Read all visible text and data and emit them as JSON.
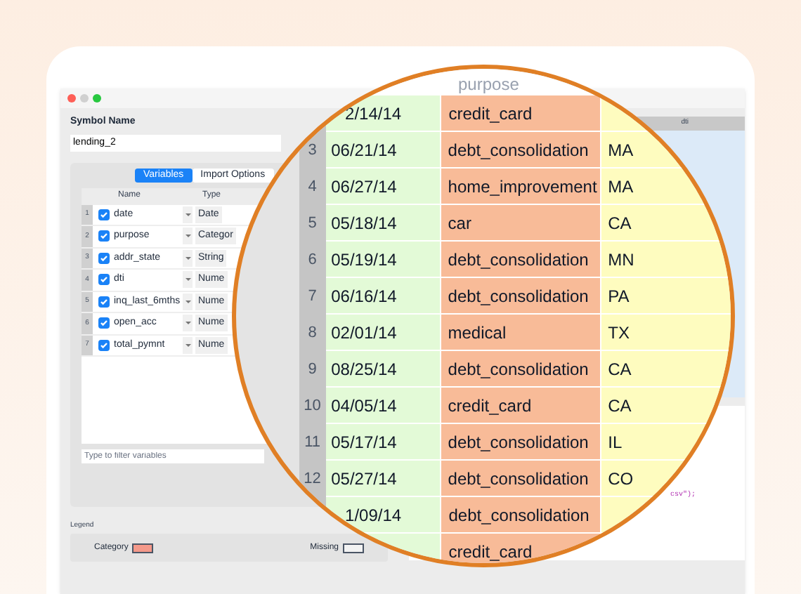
{
  "symbol_name": {
    "label": "Symbol Name",
    "value": "lending_2"
  },
  "tabs": [
    {
      "label": "Variables",
      "selected": true
    },
    {
      "label": "Import Options",
      "selected": false
    }
  ],
  "variables": {
    "columns": [
      "Name",
      "Type"
    ],
    "rows": [
      {
        "index": "1",
        "checked": true,
        "name": "date",
        "type": "Date"
      },
      {
        "index": "2",
        "checked": true,
        "name": "purpose",
        "type": "Categor"
      },
      {
        "index": "3",
        "checked": true,
        "name": "addr_state",
        "type": "String"
      },
      {
        "index": "4",
        "checked": true,
        "name": "dti",
        "type": "Nume"
      },
      {
        "index": "5",
        "checked": true,
        "name": "inq_last_6mths",
        "type": "Nume"
      },
      {
        "index": "6",
        "checked": true,
        "name": "open_acc",
        "type": "Nume"
      },
      {
        "index": "7",
        "checked": true,
        "name": "total_pymnt",
        "type": "Nume"
      }
    ]
  },
  "filter": {
    "placeholder": "Type to filter variables"
  },
  "legend": {
    "title": "Legend",
    "items": [
      {
        "label": "Category",
        "color": "#f4998a"
      },
      {
        "label": "Missing",
        "color": "#f2f2f2"
      }
    ]
  },
  "preview": {
    "column_header": "dti",
    "code": "csv\");"
  },
  "magnifier": {
    "header": "purpose",
    "rows": [
      {
        "date": "2/14/14",
        "purpose": "credit_card"
      },
      {
        "index": "3",
        "date": "06/21/14",
        "purpose": "debt_consolidation",
        "state": "MA"
      },
      {
        "index": "4",
        "date": "06/27/14",
        "purpose": "home_improvement",
        "state": "MA"
      },
      {
        "index": "5",
        "date": "05/18/14",
        "purpose": "car",
        "state": "CA"
      },
      {
        "index": "6",
        "date": "05/19/14",
        "purpose": "debt_consolidation",
        "state": "MN"
      },
      {
        "index": "7",
        "date": "06/16/14",
        "purpose": "debt_consolidation",
        "state": "PA"
      },
      {
        "index": "8",
        "date": "02/01/14",
        "purpose": "medical",
        "state": "TX"
      },
      {
        "index": "9",
        "date": "08/25/14",
        "purpose": "debt_consolidation",
        "state": "CA"
      },
      {
        "index": "10",
        "date": "04/05/14",
        "purpose": "credit_card",
        "state": "CA"
      },
      {
        "index": "11",
        "date": "05/17/14",
        "purpose": "debt_consolidation",
        "state": "IL"
      },
      {
        "index": "12",
        "date": "05/27/14",
        "purpose": "debt_consolidation",
        "state": "CO"
      },
      {
        "date": "1/09/14",
        "purpose": "debt_consolidation"
      },
      {
        "purpose": "credit_card"
      }
    ]
  }
}
